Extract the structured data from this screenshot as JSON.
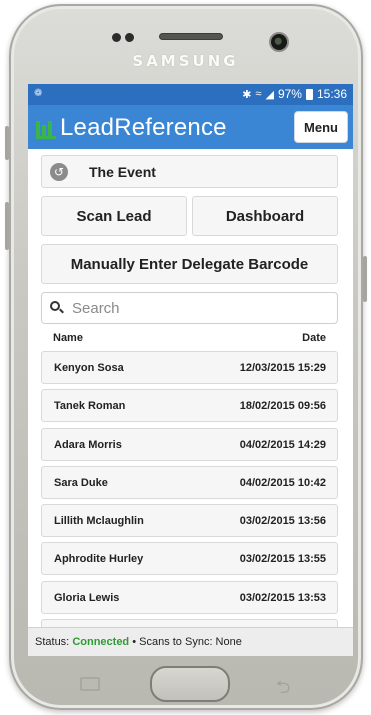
{
  "device": {
    "brand": "SAMSUNG"
  },
  "status_bar": {
    "icons": [
      "bluetooth-icon",
      "wifi-icon",
      "signal-icon"
    ],
    "battery": "97%",
    "time": "15:36"
  },
  "app_bar": {
    "title": "LeadReference",
    "menu_label": "Menu"
  },
  "event": {
    "title": "The Event"
  },
  "actions": {
    "scan_label": "Scan Lead",
    "dashboard_label": "Dashboard",
    "manual_label": "Manually Enter Delegate Barcode"
  },
  "search": {
    "placeholder": "Search",
    "value": ""
  },
  "list": {
    "header_name": "Name",
    "header_date": "Date",
    "rows": [
      {
        "name": "Kenyon Sosa",
        "date": "12/03/2015 15:29"
      },
      {
        "name": "Tanek Roman",
        "date": "18/02/2015 09:56"
      },
      {
        "name": "Adara Morris",
        "date": "04/02/2015 14:29"
      },
      {
        "name": "Sara Duke",
        "date": "04/02/2015 10:42"
      },
      {
        "name": "Lillith Mclaughlin",
        "date": "03/02/2015 13:56"
      },
      {
        "name": "Aphrodite Hurley",
        "date": "03/02/2015 13:55"
      },
      {
        "name": "Gloria Lewis",
        "date": "03/02/2015 13:53"
      },
      {
        "name": "",
        "date": ""
      }
    ]
  },
  "footer": {
    "status_label": "Status:",
    "status_value": "Connected",
    "sync_text": "• Scans to Sync: None"
  },
  "colors": {
    "status_bar": "#2d6fbf",
    "app_bar": "#3a86d4",
    "logo_green": "#3ab54a",
    "connected": "#2f9b36"
  }
}
